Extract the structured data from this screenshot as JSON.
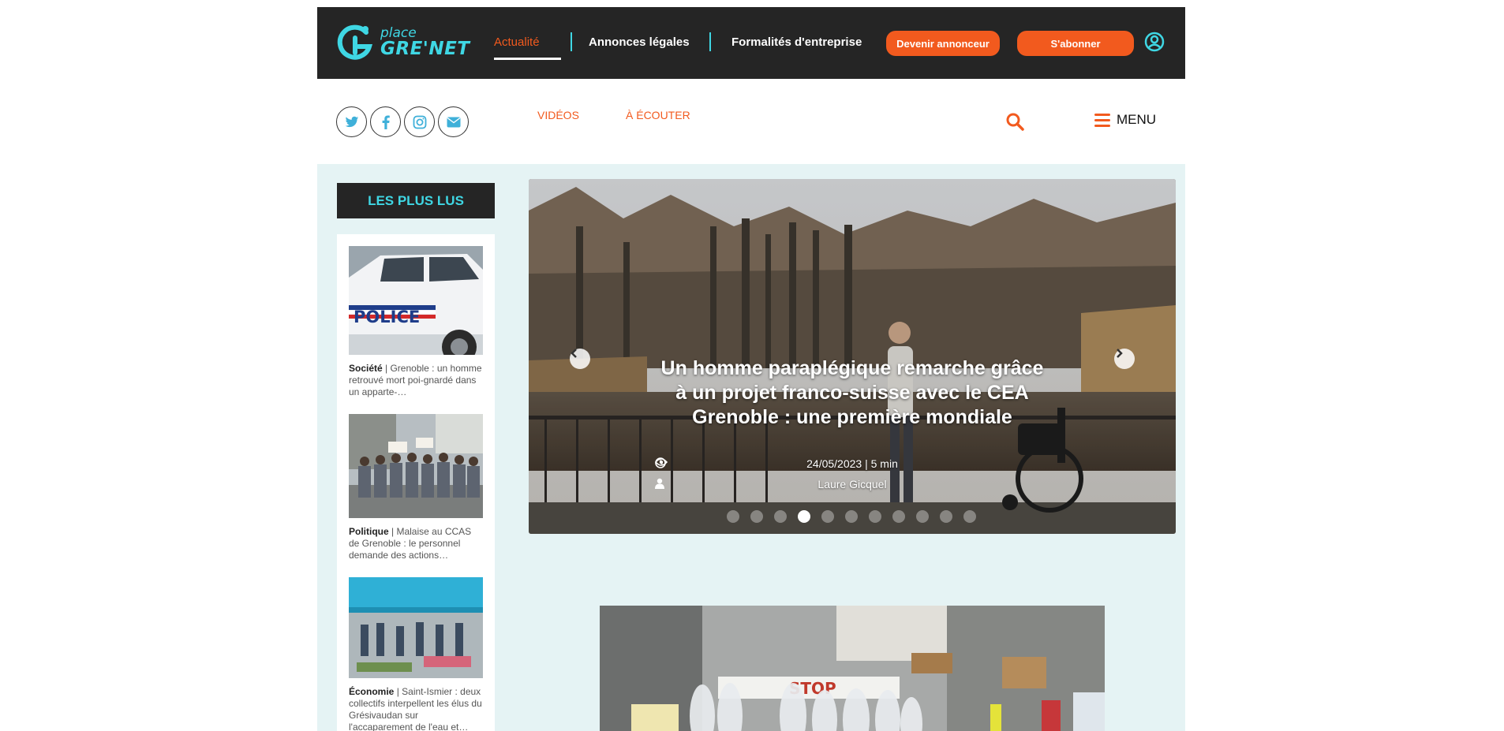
{
  "header": {
    "logo_small": "place",
    "logo_big": "GRE'NET",
    "nav": [
      {
        "label": "Actualité",
        "active": true
      },
      {
        "label": "Annonces légales"
      },
      {
        "label": "Formalités d'entreprise"
      }
    ],
    "btn_announce": "Devenir annonceur",
    "btn_subscribe": "S'abonner"
  },
  "subnav": {
    "social": [
      "twitter-icon",
      "facebook-icon",
      "instagram-icon",
      "envelope-icon"
    ],
    "links": [
      "VIDÉOS",
      "À ÉCOUTER"
    ],
    "menu_label": "MENU"
  },
  "sidebar": {
    "title": "LES PLUS LUS",
    "items": [
      {
        "category": "Société",
        "text": " | Grenoble : un homme retrouvé mort poi-gnardé dans un apparte-…"
      },
      {
        "category": "Politique",
        "text": " | Malaise au CCAS de Grenoble : le personnel demande des actions…"
      },
      {
        "category": "Économie",
        "text": " | Saint-Ismier : deux collectifs interpellent les élus du Grésivaudan sur l'accaparement de l'eau et…"
      }
    ]
  },
  "slider": {
    "title": "Un homme paraplégique remarche grâce à un projet franco-suisse avec le CEA Grenoble : une première mondiale",
    "date": "24/05/2023",
    "read_time": "5 min",
    "author": "Laure Gicquel",
    "active_slide": 4,
    "total_slides": 11
  },
  "colors": {
    "accent_orange": "#f25a1e",
    "accent_cyan": "#3fd7e4",
    "dark": "#252525",
    "content_bg": "#e5f3f4"
  }
}
